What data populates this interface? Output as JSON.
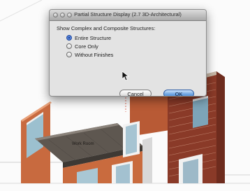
{
  "dialog": {
    "title": "Partial Structure Display (2.7 3D-Architectural)",
    "heading": "Show Complex and Composite Structures:",
    "options": [
      {
        "label": "Entire Structure",
        "selected": true
      },
      {
        "label": "Core Only",
        "selected": false
      },
      {
        "label": "Without Finishes",
        "selected": false
      }
    ],
    "cancel_label": "Cancel",
    "ok_label": "OK"
  },
  "model": {
    "room_label": "Work Room"
  }
}
